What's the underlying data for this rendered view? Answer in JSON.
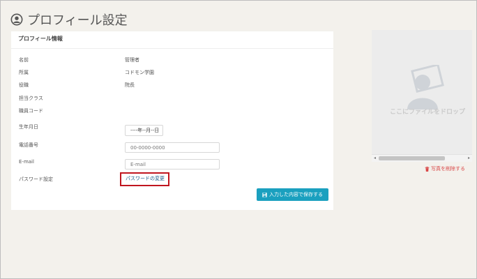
{
  "page": {
    "title": "プロフィール設定",
    "icon": "user-circle-icon"
  },
  "card": {
    "header": "プロフィール情報"
  },
  "fields": {
    "name": {
      "label": "名前",
      "value": "管理者"
    },
    "affiliation": {
      "label": "所属",
      "value": "コドモン学園"
    },
    "position": {
      "label": "役職",
      "value": "院長"
    },
    "class": {
      "label": "担当クラス"
    },
    "staff_code": {
      "label": "職員コード"
    },
    "birthday": {
      "label": "生年月日",
      "value": "----年--月--日"
    },
    "phone": {
      "label": "電話番号",
      "placeholder": "00-0000-0000"
    },
    "email": {
      "label": "E-mail",
      "placeholder": "E-mail"
    },
    "password": {
      "label": "パスワード設定",
      "link": "パスワードの変更"
    }
  },
  "actions": {
    "save_label": "入力した内容で保存する"
  },
  "photo": {
    "drop_text": "ここにファイルをドロップ",
    "delete_label": "写真を削除する"
  },
  "colors": {
    "accent": "#1aa0bf",
    "danger": "#d94848",
    "highlight": "#c0161f"
  }
}
